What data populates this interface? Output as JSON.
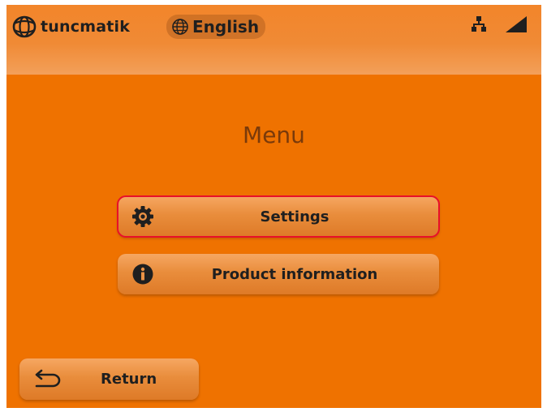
{
  "header": {
    "brand_name": "tuncmatik",
    "brand_icon": "globe-logo-icon",
    "language_label": "English",
    "language_icon": "globe-icon",
    "status_icons": [
      "network-icon",
      "signal-icon"
    ]
  },
  "page": {
    "title": "Menu"
  },
  "menu": {
    "items": [
      {
        "label": "Settings",
        "icon": "gear-icon",
        "selected": true
      },
      {
        "label": "Product information",
        "icon": "info-icon",
        "selected": false
      }
    ]
  },
  "footer": {
    "return_label": "Return",
    "return_icon": "return-arrow-icon"
  },
  "colors": {
    "background": "#ef7200",
    "header_gradient_bottom": "#f3a05a",
    "button_top": "#f6a762",
    "button_bottom": "#de7a27",
    "selection_outline": "#e8102a",
    "title_text": "#7a3a0a",
    "label_text": "#1f1f1f"
  }
}
